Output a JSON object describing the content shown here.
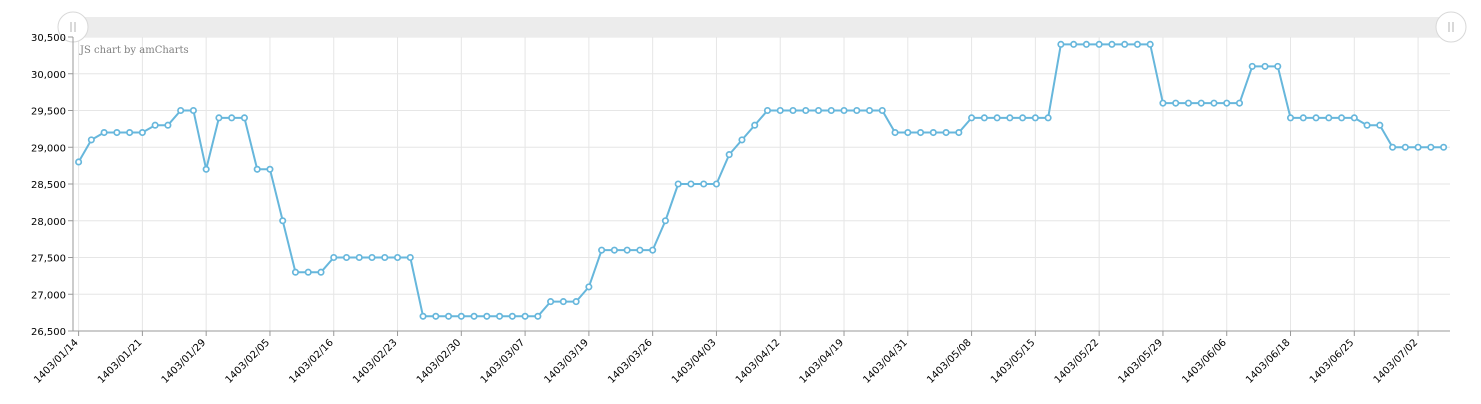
{
  "chart_data": {
    "type": "line",
    "credit": "JS chart by amCharts",
    "title": "",
    "xlabel": "",
    "ylabel": "",
    "ylim": [
      26500,
      30500
    ],
    "yticks": [
      26500,
      27000,
      27500,
      28000,
      28500,
      29000,
      29500,
      30000,
      30500
    ],
    "ytick_labels": [
      "26,500",
      "27,000",
      "27,500",
      "28,000",
      "28,500",
      "29,000",
      "29,500",
      "30,000",
      "30,500"
    ],
    "grid": true,
    "legend": "none",
    "scrollbar": true,
    "colors": {
      "line": "#67b7dc",
      "grid": "#e6e6e6",
      "axis": "#999999",
      "scrollbar": "#ececec",
      "label": "#000000"
    },
    "xtick_labels": [
      {
        "index": 0,
        "label": "1403/01/14"
      },
      {
        "index": 5,
        "label": "1403/01/21"
      },
      {
        "index": 10,
        "label": "1403/01/29"
      },
      {
        "index": 15,
        "label": "1403/02/05"
      },
      {
        "index": 20,
        "label": "1403/02/16"
      },
      {
        "index": 25,
        "label": "1403/02/23"
      },
      {
        "index": 30,
        "label": "1403/02/30"
      },
      {
        "index": 35,
        "label": "1403/03/07"
      },
      {
        "index": 40,
        "label": "1403/03/19"
      },
      {
        "index": 45,
        "label": "1403/03/26"
      },
      {
        "index": 50,
        "label": "1403/04/03"
      },
      {
        "index": 55,
        "label": "1403/04/12"
      },
      {
        "index": 60,
        "label": "1403/04/19"
      },
      {
        "index": 65,
        "label": "1403/04/31"
      },
      {
        "index": 70,
        "label": "1403/05/08"
      },
      {
        "index": 75,
        "label": "1403/05/15"
      },
      {
        "index": 80,
        "label": "1403/05/22"
      },
      {
        "index": 85,
        "label": "1403/05/29"
      },
      {
        "index": 90,
        "label": "1403/06/06"
      },
      {
        "index": 95,
        "label": "1403/06/18"
      },
      {
        "index": 100,
        "label": "1403/06/25"
      },
      {
        "index": 105,
        "label": "1403/07/02"
      }
    ],
    "series": [
      {
        "values": [
          28800,
          29100,
          29200,
          29200,
          29200,
          29200,
          29300,
          29300,
          29500,
          29500,
          28700,
          29400,
          29400,
          29400,
          28700,
          28700,
          28000,
          27300,
          27300,
          27300,
          27500,
          27500,
          27500,
          27500,
          27500,
          27500,
          27500,
          26700,
          26700,
          26700,
          26700,
          26700,
          26700,
          26700,
          26700,
          26700,
          26700,
          26900,
          26900,
          26900,
          27100,
          27600,
          27600,
          27600,
          27600,
          27600,
          28000,
          28500,
          28500,
          28500,
          28500,
          28900,
          29100,
          29300,
          29500,
          29500,
          29500,
          29500,
          29500,
          29500,
          29500,
          29500,
          29500,
          29500,
          29200,
          29200,
          29200,
          29200,
          29200,
          29200,
          29400,
          29400,
          29400,
          29400,
          29400,
          29400,
          29400,
          30400,
          30400,
          30400,
          30400,
          30400,
          30400,
          30400,
          30400,
          29600,
          29600,
          29600,
          29600,
          29600,
          29600,
          29600,
          30100,
          30100,
          30100,
          29400,
          29400,
          29400,
          29400,
          29400,
          29400,
          29300,
          29300,
          29000,
          29000,
          29000,
          29000,
          29000
        ]
      }
    ]
  }
}
